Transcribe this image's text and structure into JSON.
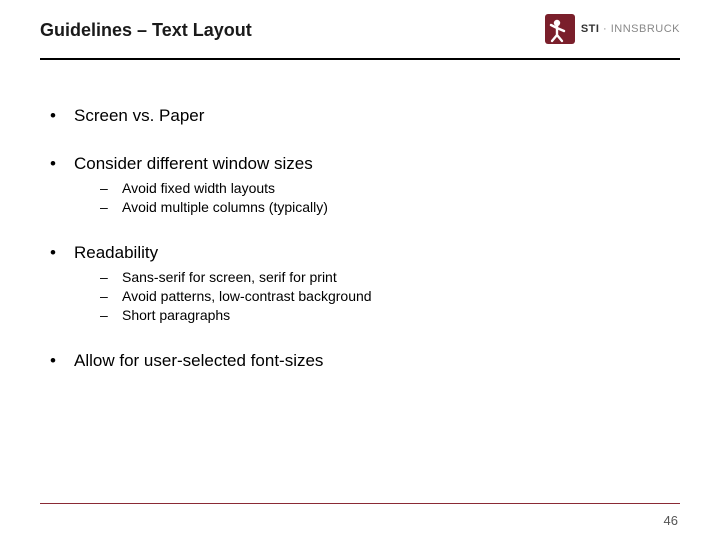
{
  "header": {
    "title": "Guidelines – Text Layout",
    "logo": {
      "text_bold": "STI",
      "text_light": " · INNSBRUCK",
      "icon_name": "sti-person-icon",
      "brand_color": "#7a1f2b"
    }
  },
  "bullets": [
    {
      "text": "Screen vs. Paper",
      "sub": []
    },
    {
      "text": "Consider different window sizes",
      "sub": [
        "Avoid fixed width layouts",
        "Avoid multiple columns (typically)"
      ]
    },
    {
      "text": "Readability",
      "sub": [
        "Sans-serif for screen, serif for print",
        "Avoid patterns, low-contrast background",
        "Short paragraphs"
      ]
    },
    {
      "text": "Allow for user-selected font-sizes",
      "sub": []
    }
  ],
  "footer": {
    "page_number": "46",
    "line_color": "#8a2a35"
  },
  "markers": {
    "l1": "•",
    "l2": "–"
  }
}
